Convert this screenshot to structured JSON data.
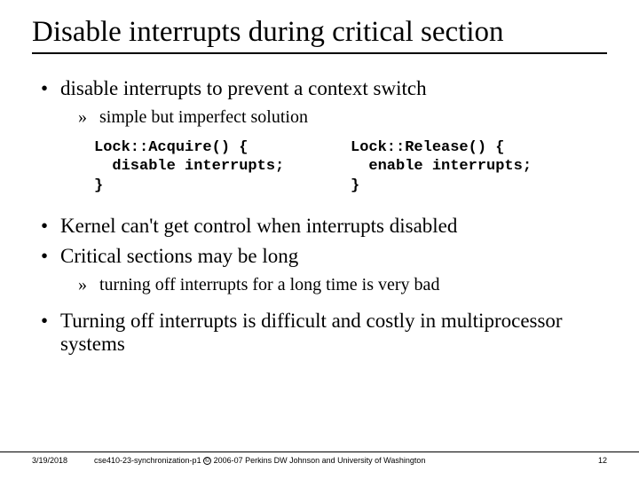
{
  "title": "Disable interrupts during critical section",
  "bullets": {
    "b1": "disable interrupts to prevent a context switch",
    "b1a": "simple but imperfect solution",
    "b2": "Kernel can't get control when interrupts disabled",
    "b3": "Critical sections may be long",
    "b3a": "turning off interrupts for a long time is very bad",
    "b4": "Turning off interrupts is difficult and costly in multiprocessor systems"
  },
  "code": {
    "left": "Lock::Acquire() {\n  disable interrupts;\n}",
    "right": "Lock::Release() {\n  enable interrupts;\n}"
  },
  "footer": {
    "date": "3/19/2018",
    "center_pre": "cse410-23-synchronization-p1 ",
    "copy": "©",
    "center_post": " 2006-07 Perkins DW Johnson and University of Washington",
    "page": "12"
  },
  "glyphs": {
    "dot": "•",
    "raquo": "»"
  }
}
